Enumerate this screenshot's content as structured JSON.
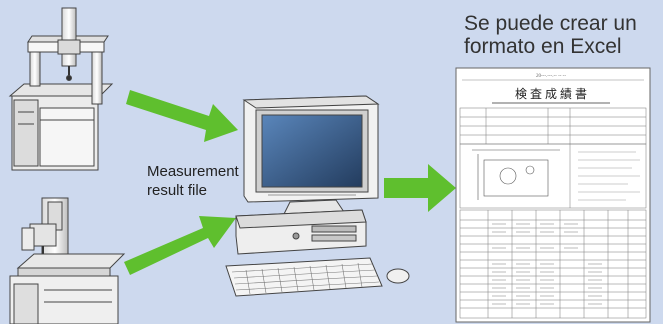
{
  "measurement_label": {
    "line1": "Measurement",
    "line2": "result file"
  },
  "excel_caption": {
    "line1": "Se puede crear un",
    "line2": "formato en Excel"
  },
  "report_sheet": {
    "header_title": "検 査 成 績 書",
    "top_line": "20---.---.-- -- --"
  },
  "colors": {
    "background": "#cdd9ee",
    "arrow": "#5fbf2e",
    "machine_body": "#f2f2f2",
    "monitor_screen": "#3a5f8c"
  }
}
